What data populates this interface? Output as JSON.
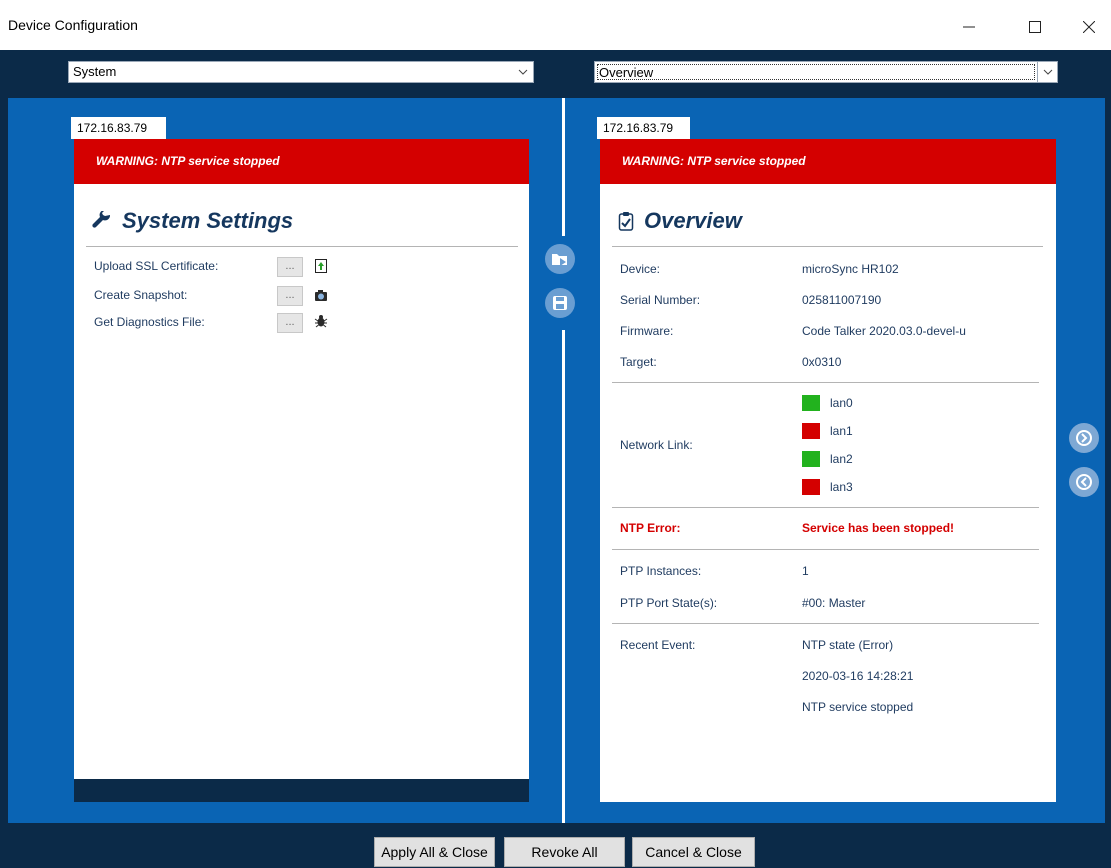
{
  "window": {
    "title": "Device Configuration"
  },
  "selectors": {
    "left_value": "System",
    "right_value": "Overview"
  },
  "left_panel": {
    "tab_label": "172.16.83.79",
    "warning": "WARNING: NTP service stopped",
    "heading": "System Settings",
    "settings": [
      {
        "label": "Upload SSL Certificate:",
        "button": "...",
        "icon": "upload-file-icon"
      },
      {
        "label": "Create Snapshot:",
        "button": "...",
        "icon": "camera-icon"
      },
      {
        "label": "Get Diagnostics File:",
        "button": "...",
        "icon": "bug-icon"
      }
    ]
  },
  "right_panel": {
    "tab_label": "172.16.83.79",
    "warning": "WARNING: NTP service stopped",
    "heading": "Overview",
    "device_label": "Device:",
    "device_value": "microSync HR102",
    "serial_label": "Serial Number:",
    "serial_value": "025811007190",
    "firmware_label": "Firmware:",
    "firmware_value": "Code Talker 2020.03.0-devel-u",
    "target_label": "Target:",
    "target_value": "0x0310",
    "network_label": "Network Link:",
    "links": [
      {
        "name": "lan0",
        "status_color": "#22b21e"
      },
      {
        "name": "lan1",
        "status_color": "#d40000"
      },
      {
        "name": "lan2",
        "status_color": "#22b21e"
      },
      {
        "name": "lan3",
        "status_color": "#d40000"
      }
    ],
    "ntp_label": "NTP Error:",
    "ntp_value": "Service has been stopped!",
    "ptp_instances_label": "PTP Instances:",
    "ptp_instances_value": "1",
    "ptp_port_label": "PTP Port State(s):",
    "ptp_port_value": "#00: Master",
    "recent_label": "Recent Event:",
    "recent_event_1": "NTP state (Error)",
    "recent_event_2": "2020-03-16 14:28:21",
    "recent_event_3": "NTP service stopped"
  },
  "buttons": {
    "apply": "Apply All & Close",
    "revoke": "Revoke All",
    "cancel": "Cancel & Close"
  },
  "colors": {
    "warning_red": "#d40000",
    "workspace_blue": "#0a64b4",
    "dark_navy": "#0b2a48"
  }
}
